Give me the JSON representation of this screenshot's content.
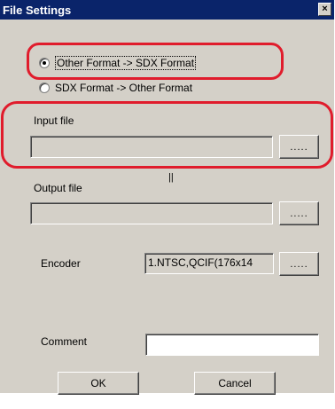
{
  "window": {
    "title": "File Settings",
    "close_glyph": "×"
  },
  "conversion": {
    "option_to_sdx": "Other Format -> SDX Format",
    "option_from_sdx": "SDX Format -> Other Format",
    "selected": "option_to_sdx"
  },
  "input_file": {
    "label": "Input file",
    "value": "",
    "browse_label": "....."
  },
  "separator_glyph": "||",
  "output_file": {
    "label": "Output file",
    "value": "",
    "browse_label": "....."
  },
  "encoder": {
    "label": "Encoder",
    "value": "1.NTSC,QCIF(176x14",
    "browse_label": "....."
  },
  "comment": {
    "label": "Comment",
    "value": ""
  },
  "buttons": {
    "ok": "OK",
    "cancel": "Cancel"
  },
  "highlight_color": "#e01c2c",
  "title_bar_color": "#0a246a"
}
